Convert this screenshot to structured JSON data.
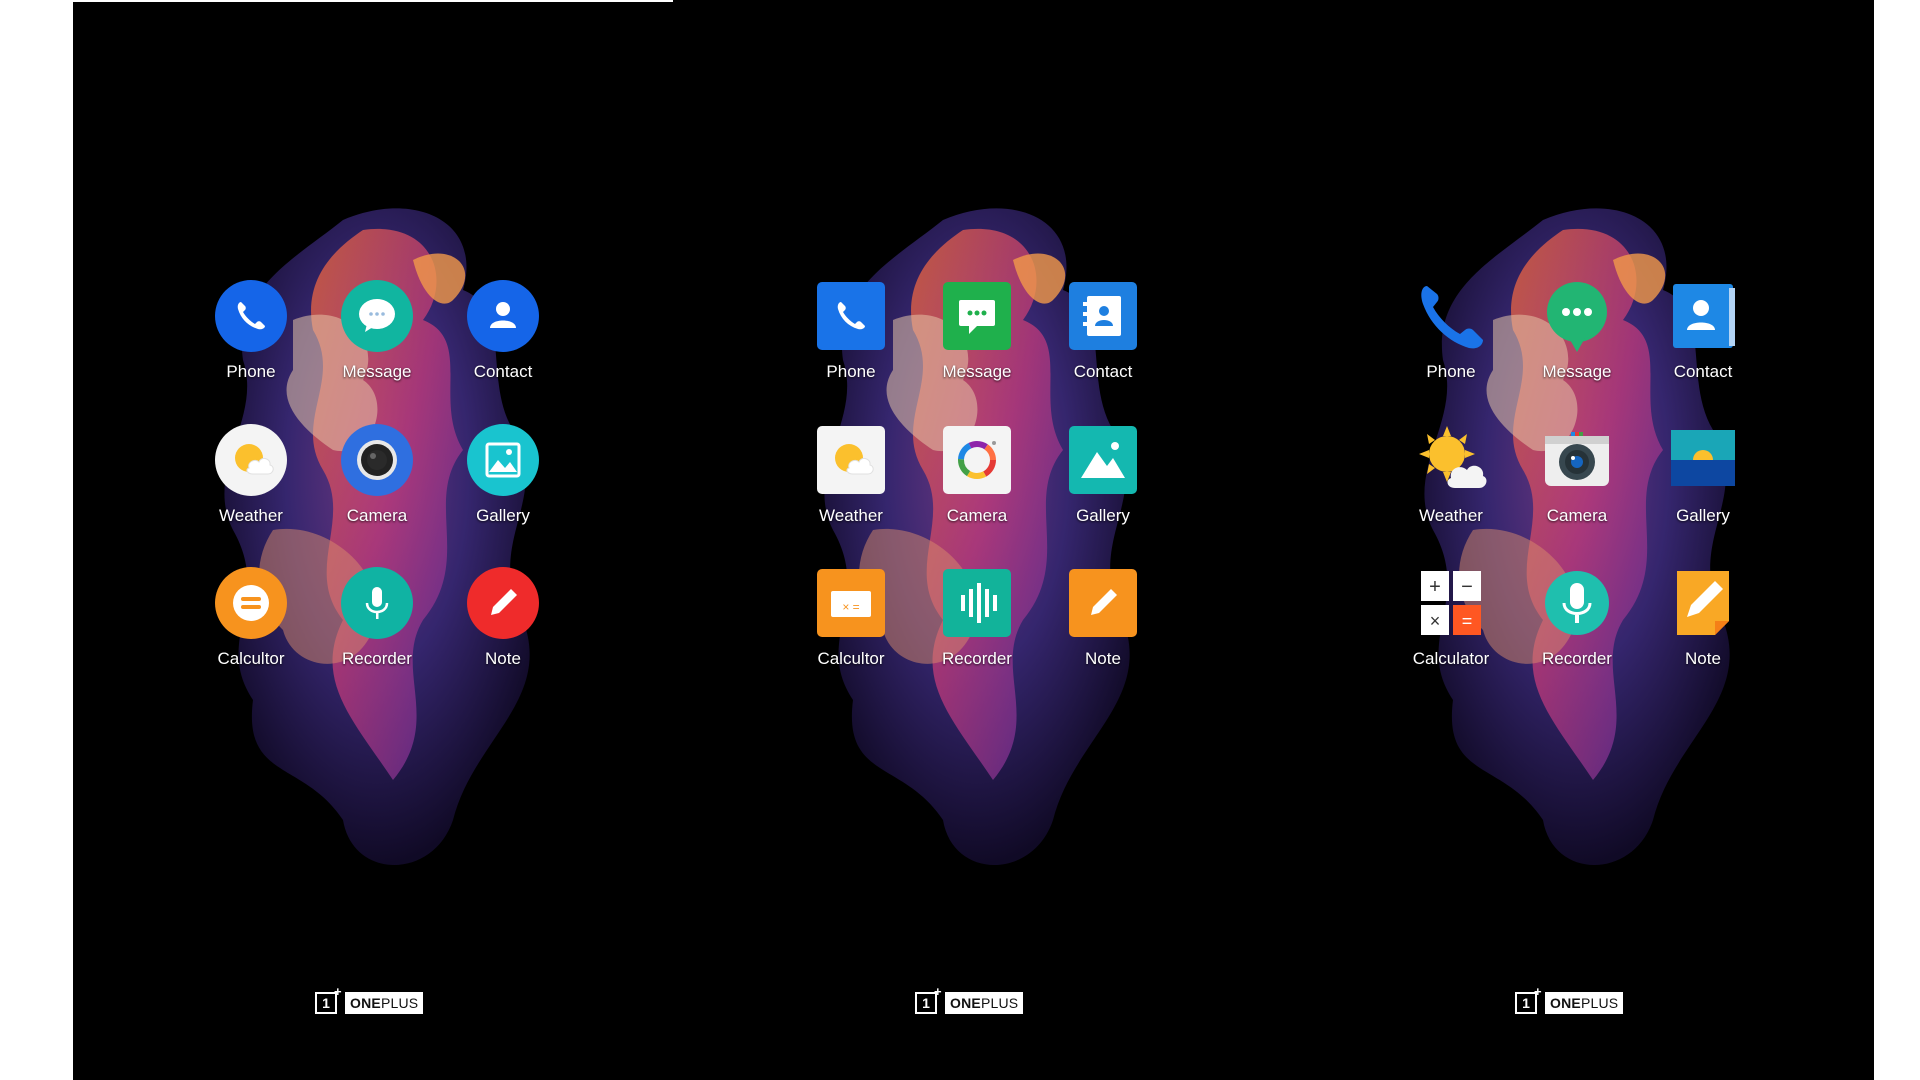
{
  "brand": {
    "logo_mark": "1",
    "logo_word_bold": "ONE",
    "logo_word_light": "PLUS"
  },
  "panels": [
    {
      "style": "round",
      "apps": [
        {
          "label": "Phone",
          "icon": "phone-icon",
          "color": "#1565e8"
        },
        {
          "label": "Message",
          "icon": "message-icon",
          "color": "#11b5a0"
        },
        {
          "label": "Contact",
          "icon": "contact-icon",
          "color": "#1565e8"
        },
        {
          "label": "Weather",
          "icon": "weather-icon",
          "color": "#f4f4f4"
        },
        {
          "label": "Camera",
          "icon": "camera-icon",
          "color": "#2f6fe0"
        },
        {
          "label": "Gallery",
          "icon": "gallery-icon",
          "color": "#19c4cf"
        },
        {
          "label": "Calcultor",
          "icon": "calculator-icon",
          "color": "#f7931e"
        },
        {
          "label": "Recorder",
          "icon": "recorder-icon",
          "color": "#10b3a3"
        },
        {
          "label": "Note",
          "icon": "note-icon",
          "color": "#ef2b2b"
        }
      ]
    },
    {
      "style": "square",
      "apps": [
        {
          "label": "Phone",
          "icon": "phone-icon",
          "color": "#1973e8"
        },
        {
          "label": "Message",
          "icon": "message-icon",
          "color": "#1fb04c"
        },
        {
          "label": "Contact",
          "icon": "contact-icon",
          "color": "#1e7fe0"
        },
        {
          "label": "Weather",
          "icon": "weather-icon",
          "color": "#f4f4f4"
        },
        {
          "label": "Camera",
          "icon": "camera-icon",
          "color": "#f4f4f4"
        },
        {
          "label": "Gallery",
          "icon": "gallery-icon",
          "color": "#14b8b0"
        },
        {
          "label": "Calcultor",
          "icon": "calculator-icon",
          "color": "#f7931e"
        },
        {
          "label": "Recorder",
          "icon": "recorder-icon",
          "color": "#12b39a"
        },
        {
          "label": "Note",
          "icon": "note-icon",
          "color": "#f7931e"
        }
      ]
    },
    {
      "style": "free",
      "apps": [
        {
          "label": "Phone",
          "icon": "phone-icon",
          "color": "#1a73e8"
        },
        {
          "label": "Message",
          "icon": "message-icon",
          "color": "#22b573"
        },
        {
          "label": "Contact",
          "icon": "contact-icon",
          "color": "#1e88e5"
        },
        {
          "label": "Weather",
          "icon": "weather-icon",
          "color": "#fbc02d"
        },
        {
          "label": "Camera",
          "icon": "camera-icon",
          "color": "#eeeeee"
        },
        {
          "label": "Gallery",
          "icon": "gallery-icon",
          "color": "#1aa6b7"
        },
        {
          "label": "Calculator",
          "icon": "calculator-icon",
          "color": "#ffffff"
        },
        {
          "label": "Recorder",
          "icon": "recorder-icon",
          "color": "#1fbfae"
        },
        {
          "label": "Note",
          "icon": "note-icon",
          "color": "#f9a825"
        }
      ]
    }
  ]
}
